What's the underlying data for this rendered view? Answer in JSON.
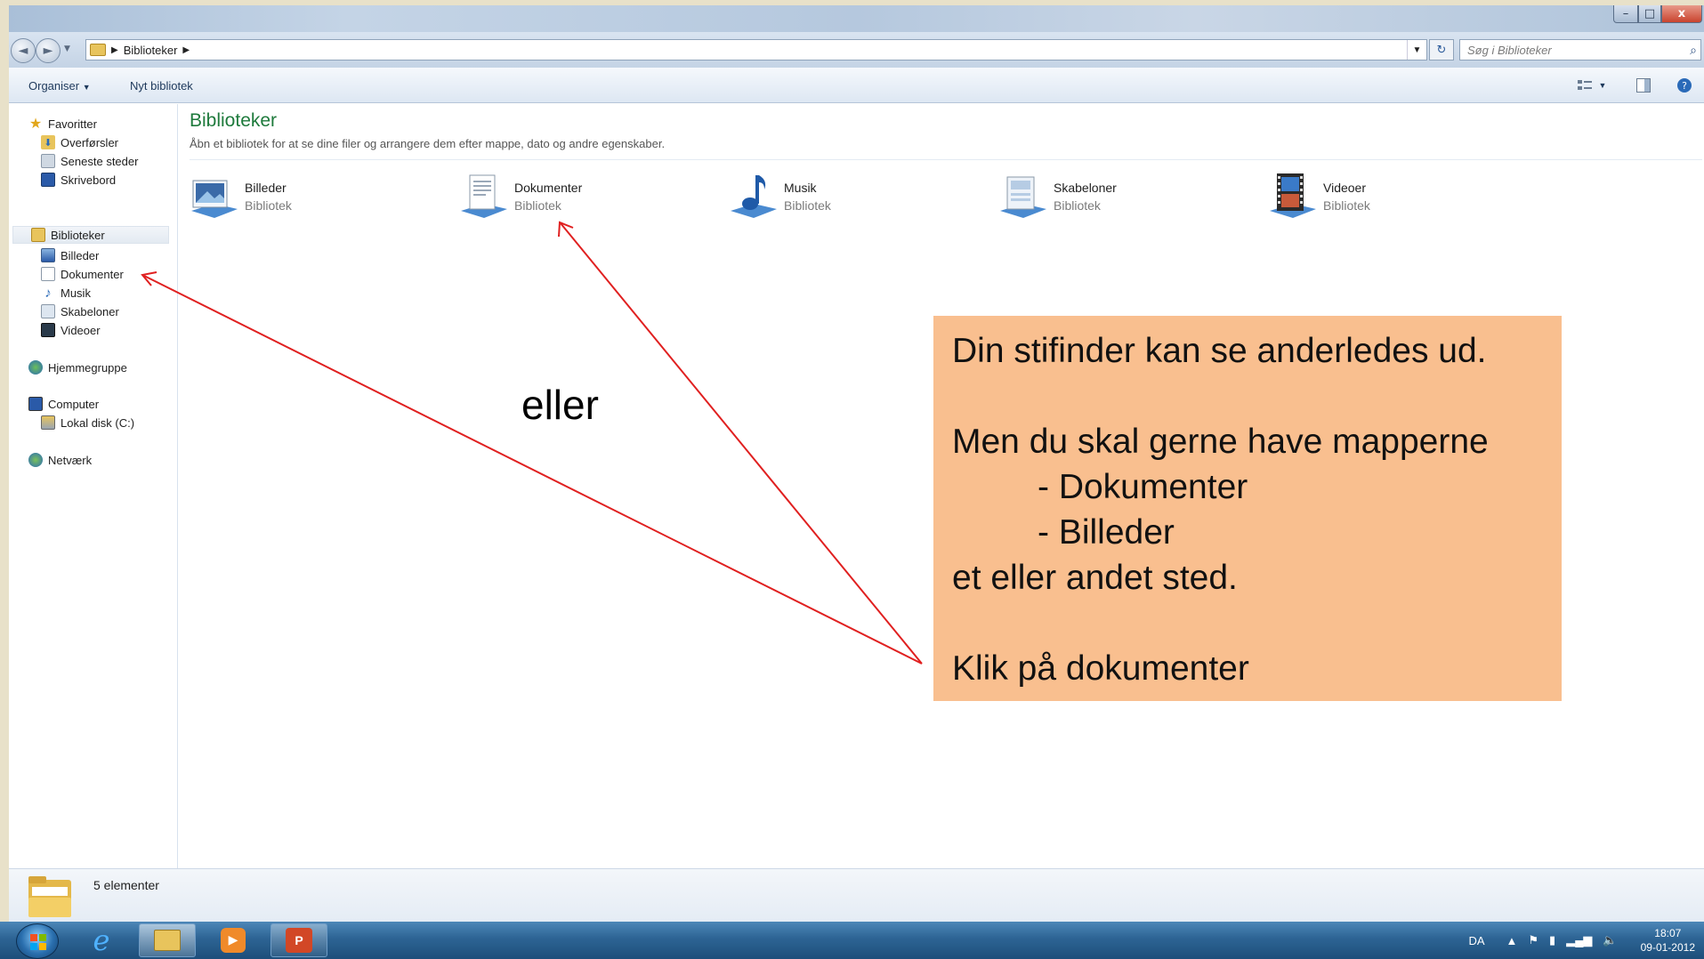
{
  "window": {
    "controls": {
      "minimize": "–",
      "maximize": "□",
      "close": "x"
    }
  },
  "navbar": {
    "back": "◄",
    "forward": "►",
    "breadcrumb": [
      "Biblioteker"
    ],
    "search_placeholder": "Søg i Biblioteker"
  },
  "cmdbar": {
    "organize": "Organiser",
    "new_library": "Nyt bibliotek"
  },
  "sidebar": {
    "groups": [
      {
        "label": "Favoritter",
        "icon": "star-icon",
        "children": [
          {
            "label": "Overførsler",
            "icon": "downloads-icon"
          },
          {
            "label": "Seneste steder",
            "icon": "recent-places-icon"
          },
          {
            "label": "Skrivebord",
            "icon": "desktop-icon"
          }
        ]
      },
      {
        "label": "Biblioteker",
        "icon": "libraries-icon",
        "selected": true,
        "children": [
          {
            "label": "Billeder",
            "icon": "pictures-icon"
          },
          {
            "label": "Dokumenter",
            "icon": "documents-icon"
          },
          {
            "label": "Musik",
            "icon": "music-icon"
          },
          {
            "label": "Skabeloner",
            "icon": "templates-icon"
          },
          {
            "label": "Videoer",
            "icon": "videos-icon"
          }
        ]
      },
      {
        "label": "Hjemmegruppe",
        "icon": "homegroup-icon",
        "children": []
      },
      {
        "label": "Computer",
        "icon": "computer-icon",
        "children": [
          {
            "label": "Lokal disk (C:)",
            "icon": "local-disk-icon"
          }
        ]
      },
      {
        "label": "Netværk",
        "icon": "network-icon",
        "children": []
      }
    ]
  },
  "content": {
    "title": "Biblioteker",
    "subtitle": "Åbn et bibliotek for at se dine filer og arrangere dem efter mappe, dato og andre egenskaber.",
    "libraries": [
      {
        "name": "Billeder",
        "type": "Bibliotek",
        "icon": "pictures-library-icon"
      },
      {
        "name": "Dokumenter",
        "type": "Bibliotek",
        "icon": "documents-library-icon"
      },
      {
        "name": "Musik",
        "type": "Bibliotek",
        "icon": "music-library-icon"
      },
      {
        "name": "Skabeloner",
        "type": "Bibliotek",
        "icon": "templates-library-icon"
      },
      {
        "name": "Videoer",
        "type": "Bibliotek",
        "icon": "videos-library-icon"
      }
    ]
  },
  "annotation": {
    "eller": "eller",
    "callout_lines": [
      "Din stifinder kan se anderledes ud.",
      "",
      "Men du skal gerne have mapperne",
      "- Dokumenter",
      "- Billeder",
      "et eller andet sted.",
      "",
      "Klik på dokumenter"
    ],
    "callout_color": "#f9bf8f",
    "arrow_color": "#e02020"
  },
  "status": {
    "count": "5 elementer"
  },
  "taskbar": {
    "language": "DA",
    "time": "18:07",
    "date": "09-01-2012"
  }
}
